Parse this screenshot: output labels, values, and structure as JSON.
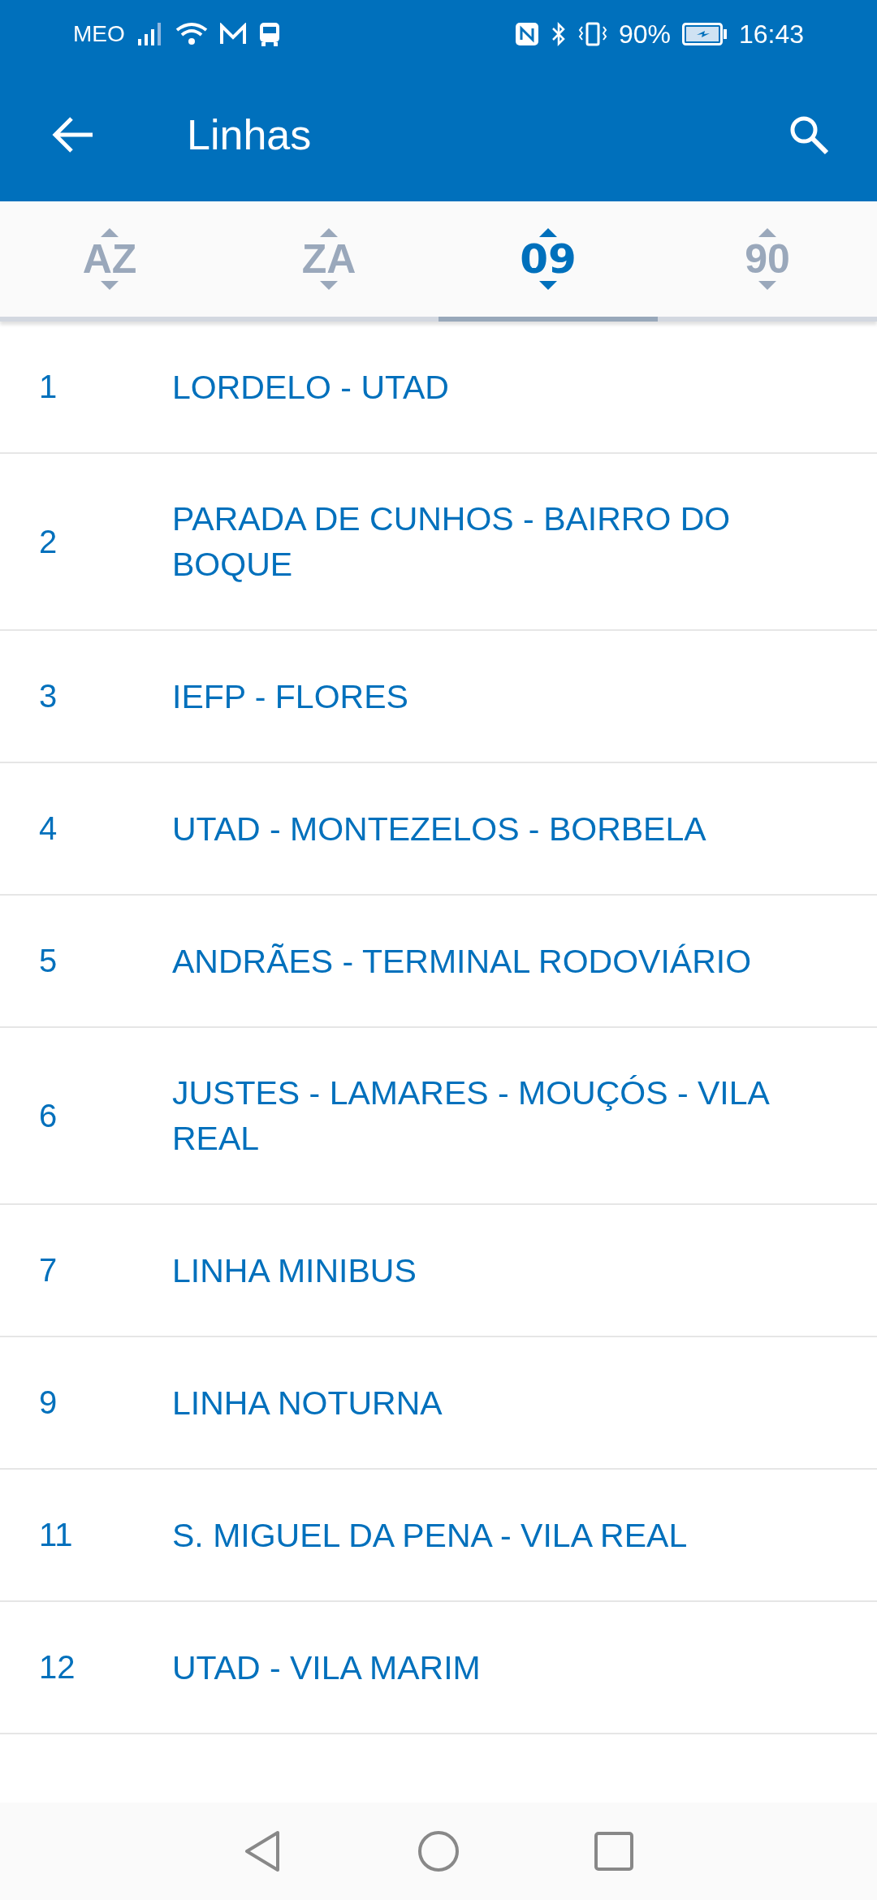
{
  "status_bar": {
    "carrier": "MEO",
    "battery": "90%",
    "time": "16:43"
  },
  "app_bar": {
    "title": "Linhas"
  },
  "tabs": [
    {
      "label": "AZ",
      "selected": false
    },
    {
      "label": "ZA",
      "selected": false
    },
    {
      "label": "09",
      "selected": true
    },
    {
      "label": "90",
      "selected": false
    }
  ],
  "lines": [
    {
      "number": "1",
      "name": "LORDELO - UTAD"
    },
    {
      "number": "2",
      "name": "PARADA DE CUNHOS - BAIRRO DO BOQUE"
    },
    {
      "number": "3",
      "name": "IEFP - FLORES"
    },
    {
      "number": "4",
      "name": "UTAD - MONTEZELOS - BORBELA"
    },
    {
      "number": "5",
      "name": "ANDRÃES - TERMINAL RODOVIÁRIO"
    },
    {
      "number": "6",
      "name": "JUSTES - LAMARES - MOUÇÓS - VILA REAL"
    },
    {
      "number": "7",
      "name": "LINHA MINIBUS"
    },
    {
      "number": "9",
      "name": "LINHA NOTURNA"
    },
    {
      "number": "11",
      "name": "S. MIGUEL DA PENA - VILA REAL"
    },
    {
      "number": "12",
      "name": "UTAD - VILA MARIM"
    }
  ]
}
